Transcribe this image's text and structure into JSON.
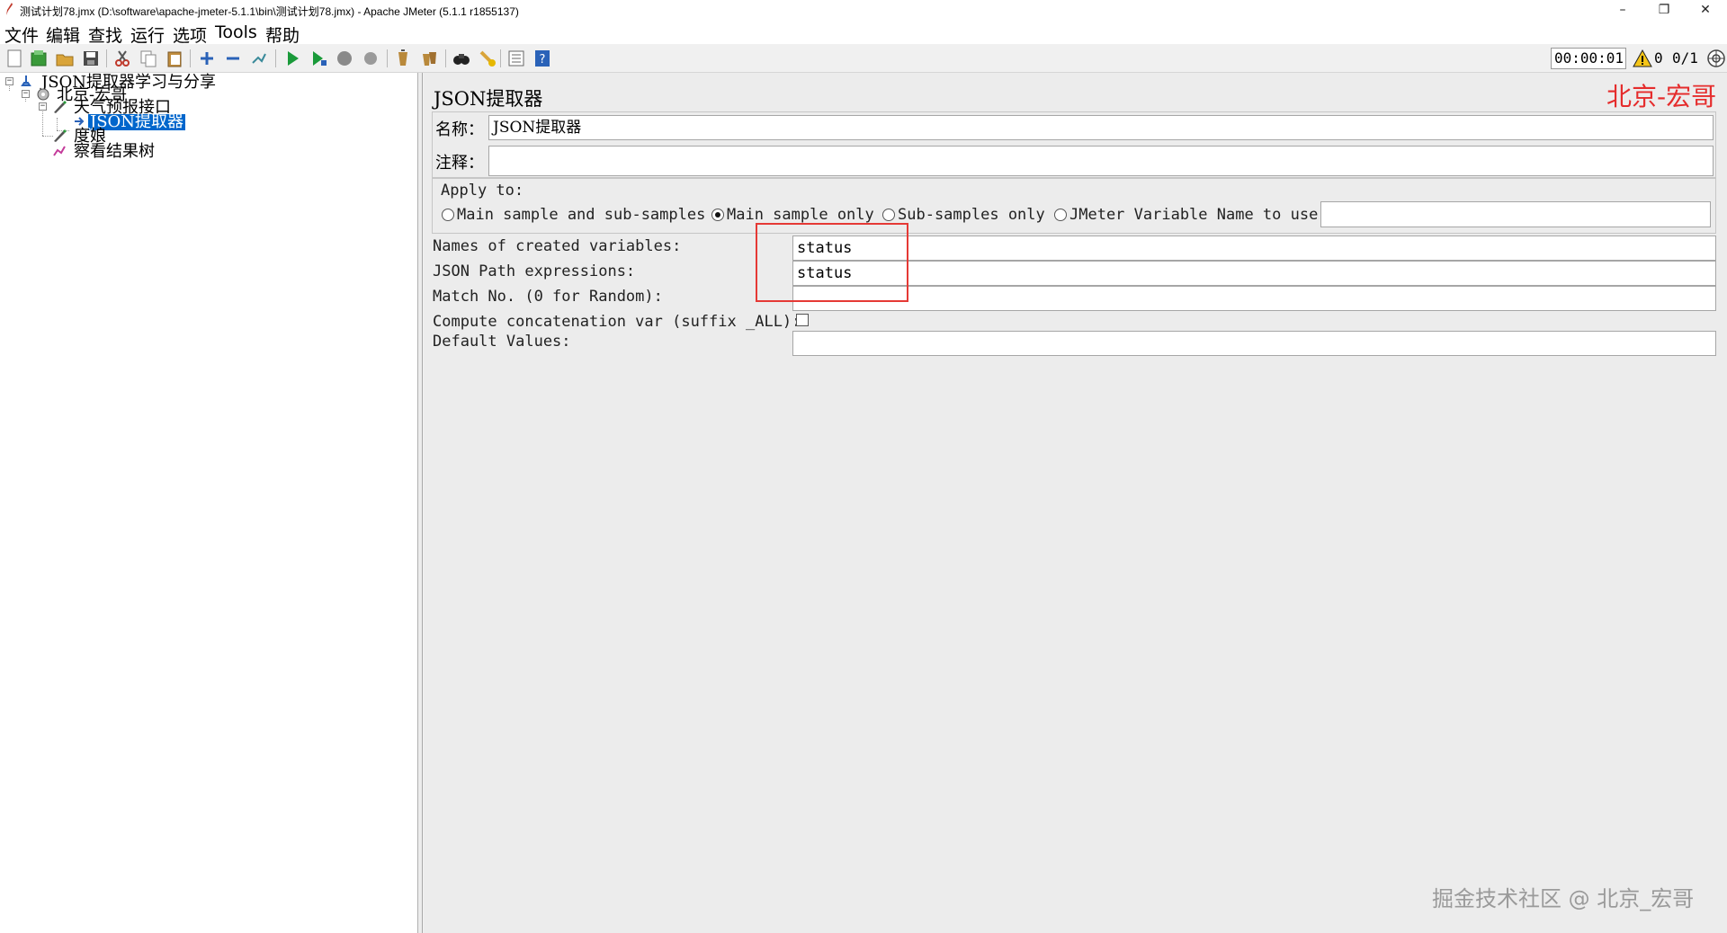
{
  "window": {
    "title": "测试计划78.jmx (D:\\software\\apache-jmeter-5.1.1\\bin\\测试计划78.jmx) - Apache JMeter (5.1.1 r1855137)",
    "minimize": "–",
    "restore": "❐",
    "close": "✕"
  },
  "menu": [
    "文件",
    "编辑",
    "查找",
    "运行",
    "选项",
    "Tools",
    "帮助"
  ],
  "toolbar": {
    "timer": "00:00:01",
    "warnings": "0",
    "threads": "0/1",
    "icons": [
      "new-icon",
      "templates-icon",
      "open-icon",
      "save-icon",
      "cut-icon",
      "copy-icon",
      "paste-icon",
      "expand-icon",
      "collapse-icon",
      "toggle-icon",
      "start-icon",
      "start-no-pause-icon",
      "stop-icon",
      "shutdown-icon",
      "clear-icon",
      "clear-all-icon",
      "search-icon",
      "reset-search-icon",
      "function-helper-icon",
      "help-icon"
    ]
  },
  "tree": {
    "root": "JSON提取器学习与分享",
    "group": "北京-宏哥",
    "sampler": "天气预报接口",
    "extractor": "JSON提取器",
    "sampler2": "度娘",
    "listener": "察看结果树"
  },
  "panel": {
    "title": "JSON提取器",
    "watermark": "北京-宏哥",
    "name_label": "名称：",
    "name_value": "JSON提取器",
    "comment_label": "注释：",
    "comment_value": "",
    "apply_to": "Apply to:",
    "radio_main_sub": "Main sample and sub-samples",
    "radio_main_only": "Main sample only",
    "radio_sub_only": "Sub-samples only",
    "radio_var": "JMeter Variable Name to use",
    "var_value": "",
    "names_label": "Names of created variables:",
    "names_value": "status",
    "paths_label": "JSON Path expressions:",
    "paths_value": "status",
    "match_label": "Match No. (0 for Random):",
    "match_value": "",
    "concat_label": "Compute concatenation var (suffix _ALL):",
    "default_label": "Default Values:",
    "default_value": ""
  },
  "footer_watermark": "掘金技术社区 @ 北京_宏哥"
}
